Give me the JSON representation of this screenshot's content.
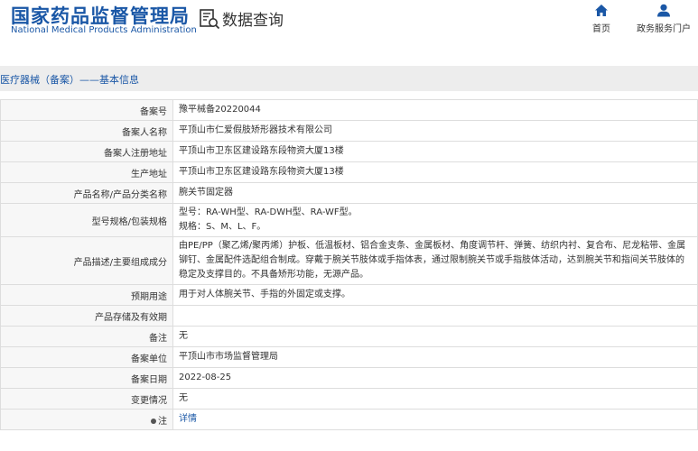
{
  "header": {
    "logo_cn": "国家药品监督管理局",
    "logo_en": "National Medical Products Administration",
    "title": "数据查询",
    "nav": [
      {
        "label": "首页",
        "icon": "home-icon"
      },
      {
        "label": "政务服务门户",
        "icon": "user-icon"
      }
    ]
  },
  "breadcrumb": "医疗器械（备案）——基本信息",
  "colors": {
    "brand": "#1a57a6",
    "label_bg": "#f7f7f7",
    "crumb_bg": "#ededed"
  },
  "rows": [
    {
      "label": "备案号",
      "value": "豫平械备20220044"
    },
    {
      "label": "备案人名称",
      "value": "平顶山市仁爱假肢矫形器技术有限公司"
    },
    {
      "label": "备案人注册地址",
      "value": "平顶山市卫东区建设路东段物资大厦13楼"
    },
    {
      "label": "生产地址",
      "value": "平顶山市卫东区建设路东段物资大厦13楼"
    },
    {
      "label": "产品名称/产品分类名称",
      "value": "腕关节固定器"
    },
    {
      "label": "型号规格/包装规格",
      "line1": "型号：RA-WH型、RA-DWH型、RA-WF型。",
      "line2": "规格：S、M、L、F。"
    },
    {
      "label": "产品描述/主要组成成分",
      "value": "由PE/PP（聚乙烯/聚丙烯）护板、低温板材、铝合金支条、金属板材、角度调节杆、弹簧、纺织内衬、复合布、尼龙粘带、金属铆钉、金属配件选配组合制成。穿戴于腕关节肢体或手指体表，通过限制腕关节或手指肢体活动，达到腕关节和指间关节肢体的稳定及支撑目的。不具备矫形功能，无源产品。"
    },
    {
      "label": "预期用途",
      "value": "用于对人体腕关节、手指的外固定或支撑。"
    },
    {
      "label": "产品存储及有效期",
      "value": ""
    },
    {
      "label": "备注",
      "value": "无"
    },
    {
      "label": "备案单位",
      "value": "平顶山市市场监督管理局"
    },
    {
      "label": "备案日期",
      "value": "2022-08-25"
    },
    {
      "label": "变更情况",
      "value": "无"
    },
    {
      "label": "注",
      "value": "详情"
    }
  ]
}
